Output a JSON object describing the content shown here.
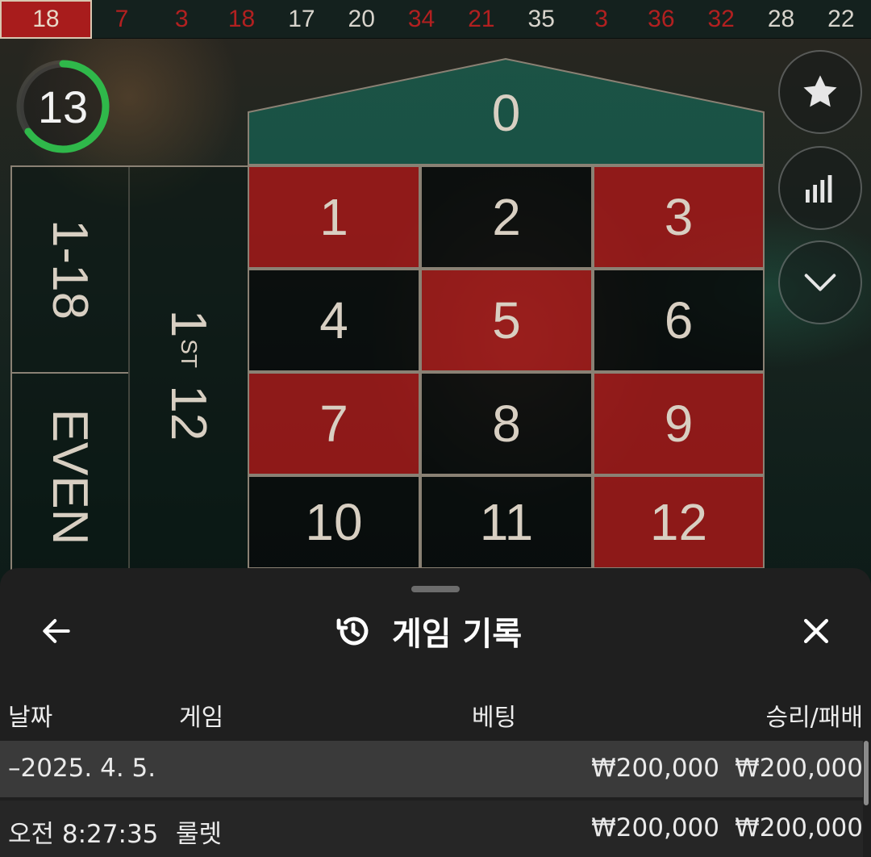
{
  "history": [
    {
      "value": "18",
      "color": "red"
    },
    {
      "value": "7",
      "color": "red"
    },
    {
      "value": "3",
      "color": "red"
    },
    {
      "value": "18",
      "color": "red"
    },
    {
      "value": "17",
      "color": "black"
    },
    {
      "value": "20",
      "color": "black"
    },
    {
      "value": "34",
      "color": "red"
    },
    {
      "value": "21",
      "color": "red"
    },
    {
      "value": "35",
      "color": "black"
    },
    {
      "value": "3",
      "color": "red"
    },
    {
      "value": "36",
      "color": "red"
    },
    {
      "value": "32",
      "color": "red"
    },
    {
      "value": "28",
      "color": "black"
    },
    {
      "value": "22",
      "color": "black"
    }
  ],
  "timer": {
    "seconds": "13",
    "progress": 0.65,
    "color": "#2fb84a"
  },
  "table": {
    "zero": "0",
    "numbers": [
      {
        "n": "1",
        "color": "red"
      },
      {
        "n": "2",
        "color": "black"
      },
      {
        "n": "3",
        "color": "red"
      },
      {
        "n": "4",
        "color": "black"
      },
      {
        "n": "5",
        "color": "red"
      },
      {
        "n": "6",
        "color": "black"
      },
      {
        "n": "7",
        "color": "red"
      },
      {
        "n": "8",
        "color": "black"
      },
      {
        "n": "9",
        "color": "red"
      },
      {
        "n": "10",
        "color": "black"
      },
      {
        "n": "11",
        "color": "black"
      },
      {
        "n": "12",
        "color": "red"
      }
    ],
    "low_bet": "1-18",
    "even_bet": "EVEN",
    "dozen": {
      "num": "1",
      "suffix": "ST",
      "label": "12"
    }
  },
  "side_buttons": [
    "star-icon",
    "statistics-icon",
    "chevron-down-icon"
  ],
  "sheet": {
    "title": "게임 기록",
    "columns": {
      "date": "날짜",
      "game": "게임",
      "bet": "베팅",
      "result": "승리/패배"
    },
    "group_row": {
      "date": "–2025. 4. 5.",
      "bet": "₩200,000",
      "win": "₩200,000"
    },
    "item_row": {
      "time": "오전 8:27:35",
      "game": "룰렛",
      "bet": "₩200,000",
      "win": "₩200,000"
    }
  }
}
